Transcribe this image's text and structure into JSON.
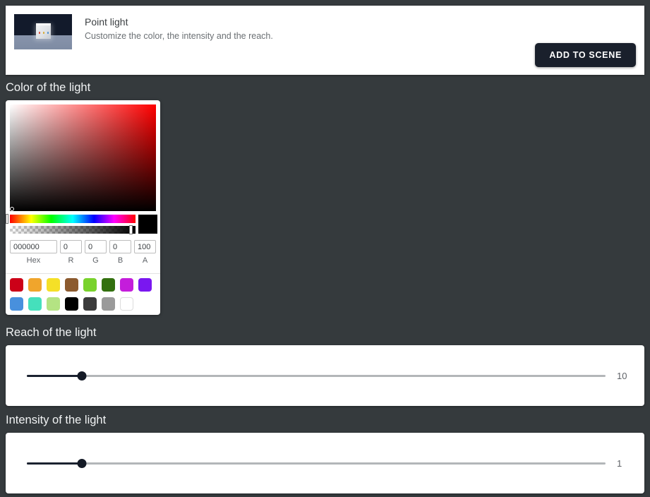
{
  "header": {
    "title": "Point light",
    "subtitle": "Customize the color, the intensity and the reach.",
    "add_button_label": "ADD TO SCENE",
    "thumbnail_name": "point-light-preview-thumbnail"
  },
  "sections": {
    "color_heading": "Color of the light",
    "reach_heading": "Reach of the light",
    "intensity_heading": "Intensity of the light"
  },
  "color_picker": {
    "current_color_hex": "#000000",
    "fields": {
      "hex_value": "000000",
      "hex_label": "Hex",
      "r_value": "0",
      "r_label": "R",
      "g_value": "0",
      "g_label": "G",
      "b_value": "0",
      "b_label": "B",
      "a_value": "100",
      "a_label": "A"
    },
    "swatches": [
      {
        "name": "swatch-red",
        "color": "#cc0018"
      },
      {
        "name": "swatch-orange",
        "color": "#f0a52c"
      },
      {
        "name": "swatch-yellow",
        "color": "#f5e027"
      },
      {
        "name": "swatch-brown",
        "color": "#8c5a2e"
      },
      {
        "name": "swatch-light-green",
        "color": "#79d22c"
      },
      {
        "name": "swatch-dark-green",
        "color": "#33700f"
      },
      {
        "name": "swatch-magenta",
        "color": "#c41ddb"
      },
      {
        "name": "swatch-purple",
        "color": "#7a17f0"
      },
      {
        "name": "swatch-blue",
        "color": "#4890dd"
      },
      {
        "name": "swatch-turquoise",
        "color": "#45e0bc"
      },
      {
        "name": "swatch-pale-green",
        "color": "#b4e383"
      },
      {
        "name": "swatch-black",
        "color": "#000000"
      },
      {
        "name": "swatch-dark-gray",
        "color": "#3b3b3b"
      },
      {
        "name": "swatch-gray",
        "color": "#9a9a9a"
      },
      {
        "name": "swatch-white",
        "color": "#ffffff"
      }
    ]
  },
  "reach_slider": {
    "value": "10",
    "fill_percent": 9.5
  },
  "intensity_slider": {
    "value": "1",
    "fill_percent": 9.5
  }
}
